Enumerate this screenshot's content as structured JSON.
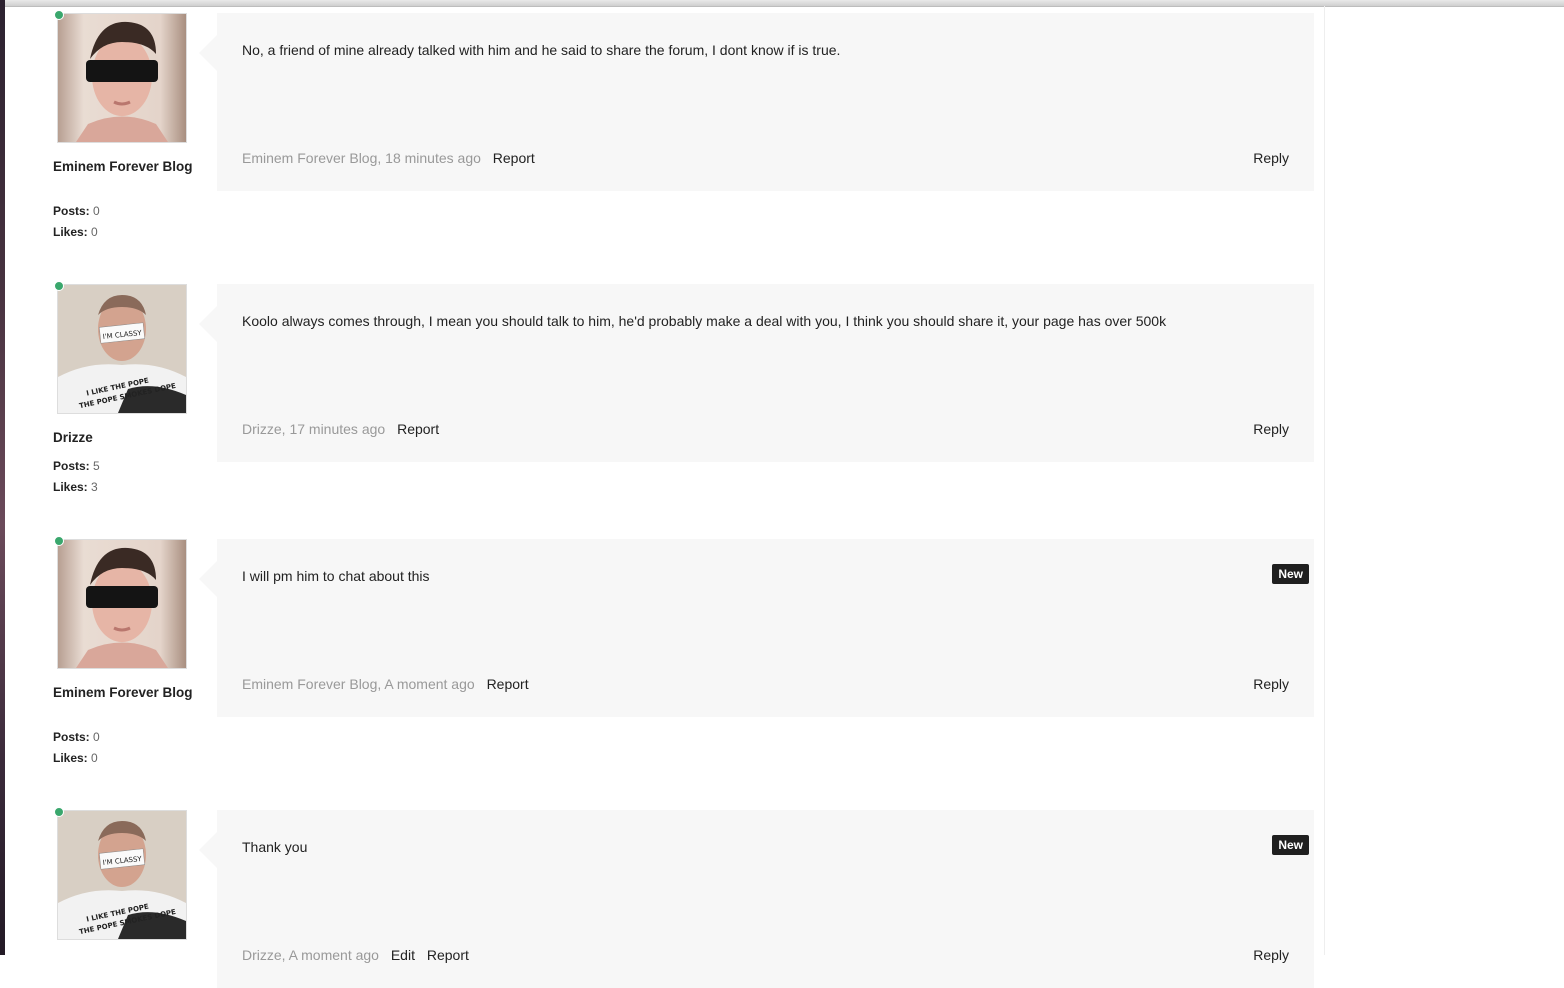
{
  "posts": [
    {
      "author": "Eminem Forever Blog",
      "avatar": "sunglasses-portrait",
      "posts_label": "Posts:",
      "posts_count": "0",
      "likes_label": "Likes:",
      "likes_count": "0",
      "message": "No, a friend of mine already talked with him and he said to share the forum, I dont know if is true.",
      "meta": "Eminem Forever Blog, 18 minutes ago",
      "report": "Report",
      "reply": "Reply"
    },
    {
      "author": "Drizze",
      "avatar": "taped-mouth-portrait",
      "posts_label": "Posts:",
      "posts_count": "5",
      "likes_label": "Likes:",
      "likes_count": "3",
      "message": "Koolo always comes through, I mean you should talk to him, he'd probably make a deal with you, I think you should share it, your page has over 500k",
      "meta": "Drizze, 17 minutes ago",
      "report": "Report",
      "reply": "Reply"
    },
    {
      "author": "Eminem Forever Blog",
      "avatar": "sunglasses-portrait",
      "posts_label": "Posts:",
      "posts_count": "0",
      "likes_label": "Likes:",
      "likes_count": "0",
      "message": "I will pm him to chat about this",
      "meta": "Eminem Forever Blog, A moment ago",
      "report": "Report",
      "reply": "Reply",
      "badge": "New"
    },
    {
      "author": "Drizze",
      "avatar": "taped-mouth-portrait",
      "message": "Thank you",
      "meta": "Drizze, A moment ago",
      "edit": "Edit",
      "report": "Report",
      "reply": "Reply",
      "badge": "New"
    }
  ],
  "avatar_text": {
    "tape": "I'M CLASSY",
    "shirt_line1": "I LIKE THE POPE",
    "shirt_line2": "THE POPE SMOKES DOPE"
  }
}
